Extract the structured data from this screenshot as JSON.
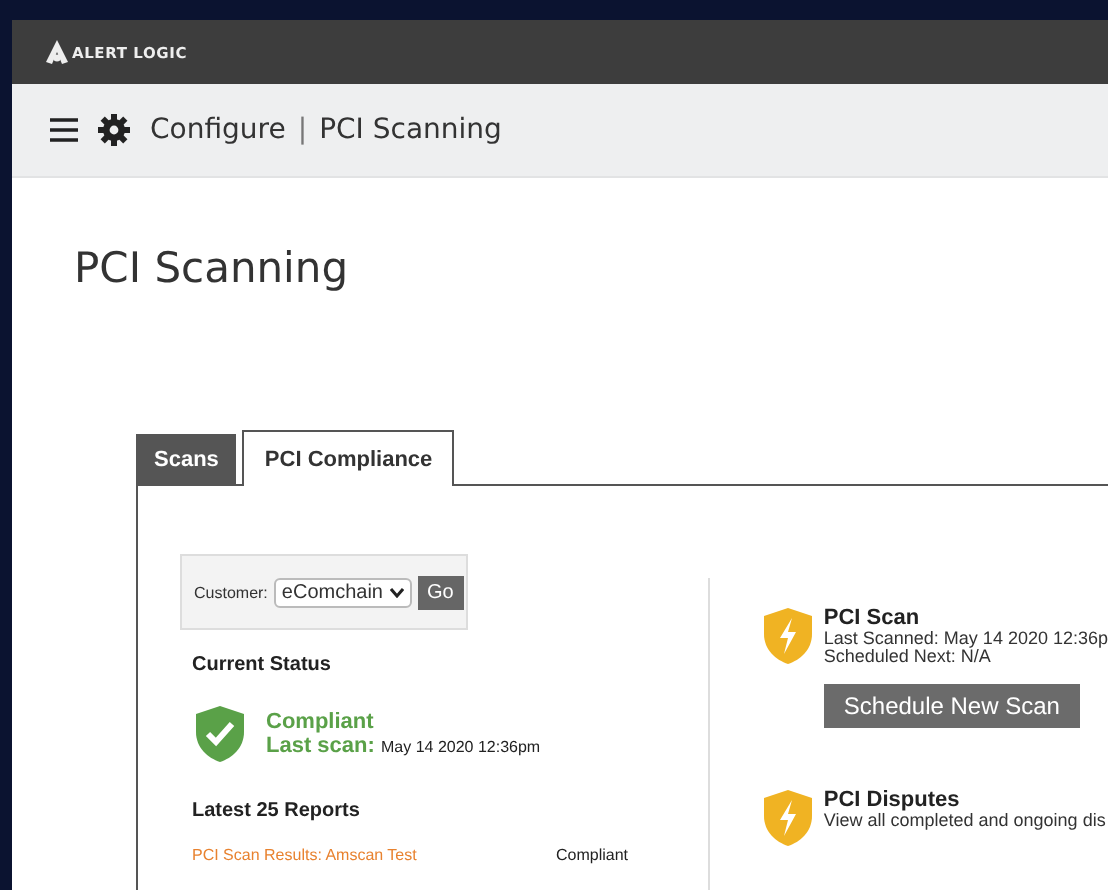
{
  "brand": {
    "name": "ALERT LOGIC"
  },
  "breadcrumb": {
    "section": "Configure",
    "separator": "|",
    "page": "PCI Scanning"
  },
  "page_title": "PCI Scanning",
  "tabs": [
    {
      "label": "Scans",
      "selected": false
    },
    {
      "label": "PCI Compliance",
      "selected": true
    }
  ],
  "customer": {
    "label": "Customer:",
    "value": "eComchain",
    "button": "Go"
  },
  "current_status": {
    "heading": "Current Status",
    "status": "Compliant",
    "compliant": true,
    "last_scan_label": "Last scan:",
    "last_scan": "May 14 2020 12:36pm"
  },
  "reports": {
    "heading": "Latest 25 Reports",
    "rows": [
      {
        "name": "PCI Scan Results: Amscan Test",
        "status": "Compliant"
      }
    ]
  },
  "cards": [
    {
      "title": "PCI Scan",
      "lines": [
        "Last Scanned: May 14 2020 12:36p",
        "Scheduled Next: N/A"
      ],
      "button": "Schedule New Scan"
    },
    {
      "title": "PCI Disputes",
      "lines": [
        "View all completed and ongoing dis"
      ]
    }
  ]
}
